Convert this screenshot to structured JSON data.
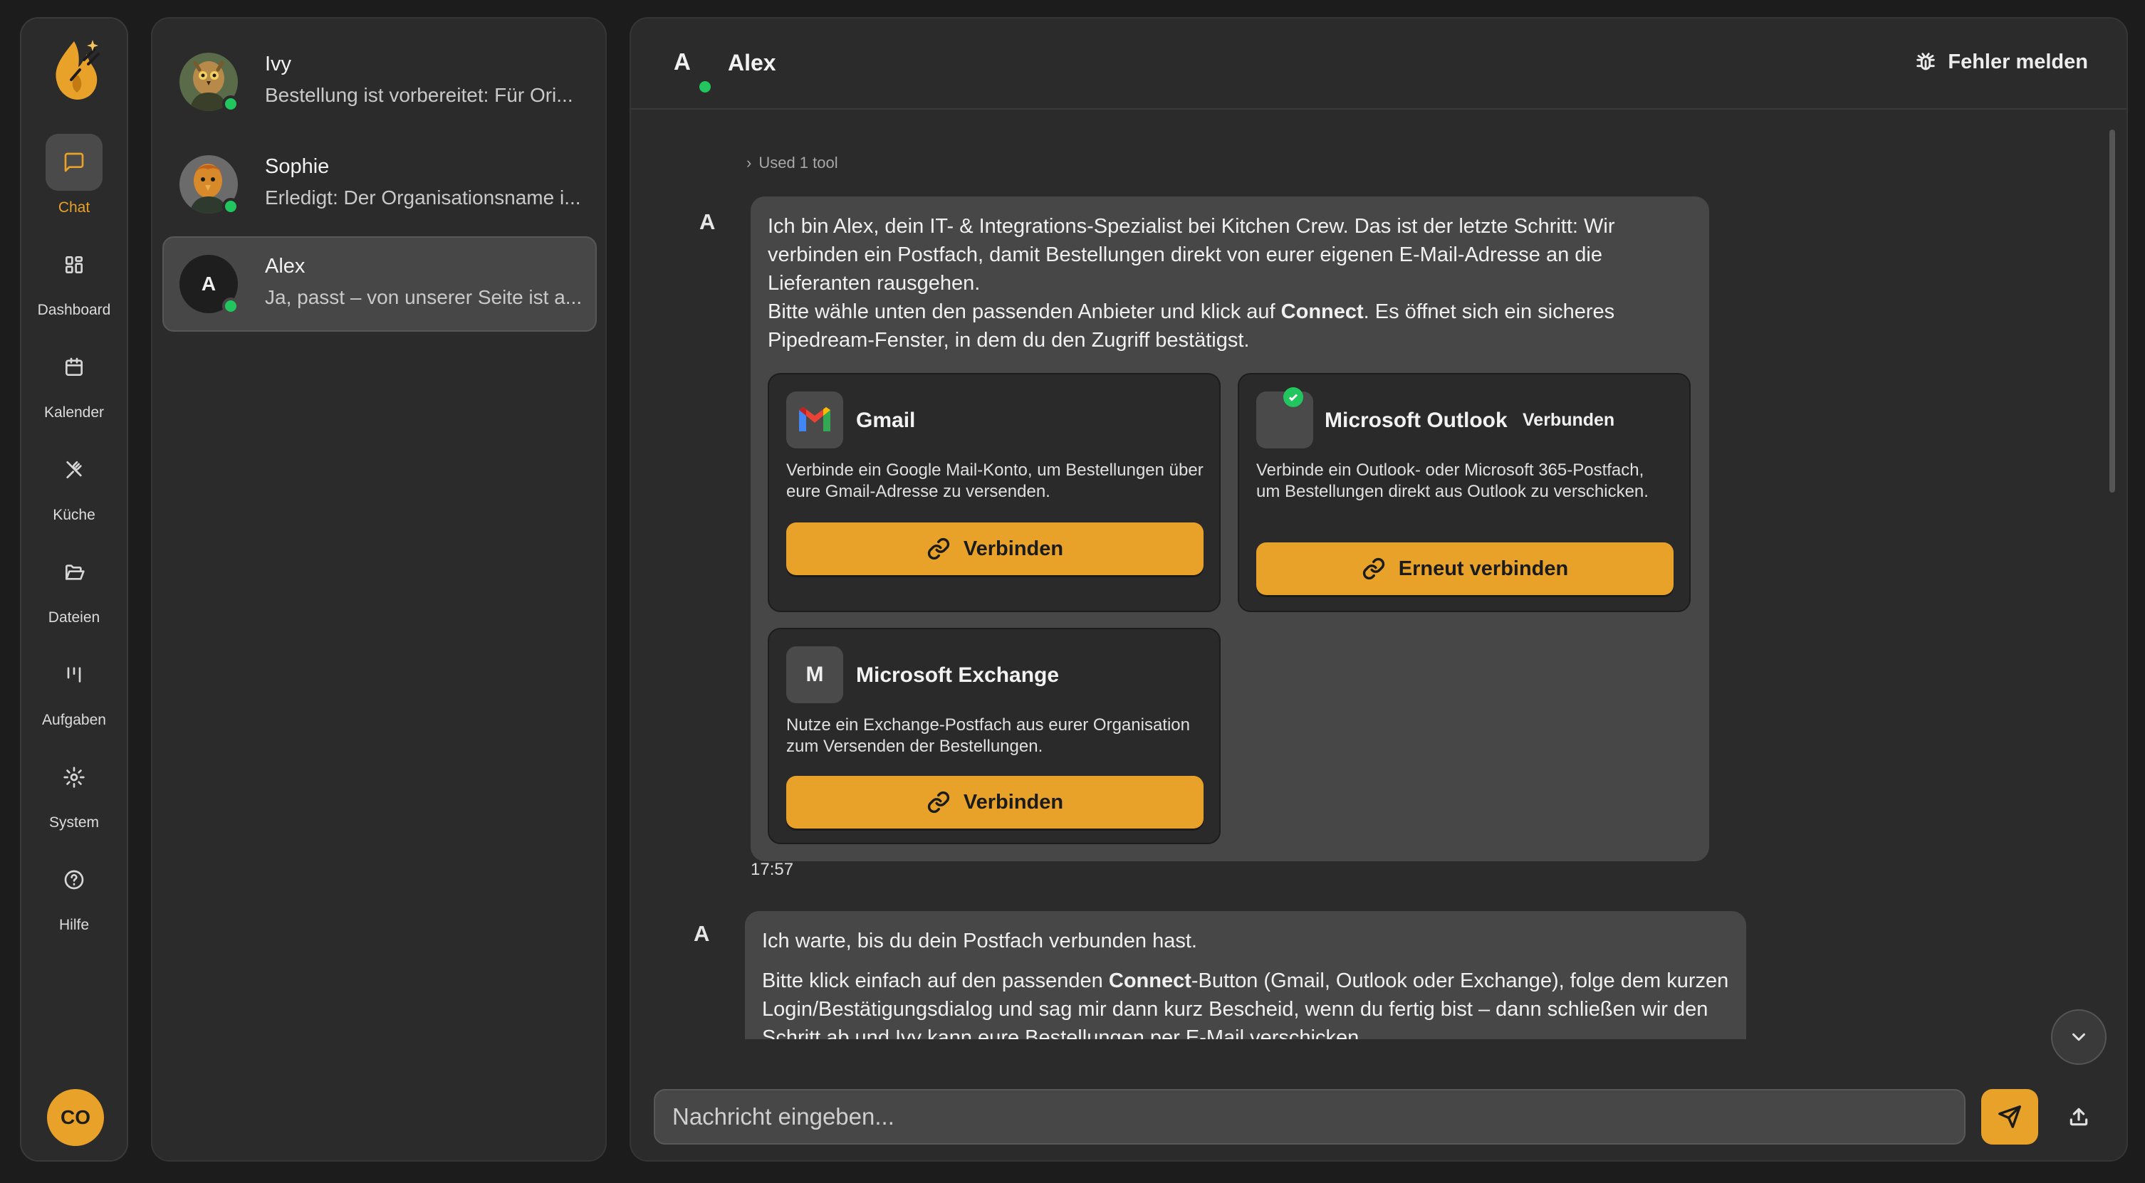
{
  "nav": {
    "items": [
      {
        "label": "Chat",
        "icon": "message-square-icon",
        "active": true
      },
      {
        "label": "Dashboard",
        "icon": "dashboard-grid-icon"
      },
      {
        "label": "Kalender",
        "icon": "calendar-icon"
      },
      {
        "label": "Küche",
        "icon": "utensils-icon"
      },
      {
        "label": "Dateien",
        "icon": "folder-open-icon"
      },
      {
        "label": "Aufgaben",
        "icon": "kanban-icon"
      },
      {
        "label": "System",
        "icon": "gear-icon"
      },
      {
        "label": "Hilfe",
        "icon": "help-circle-icon"
      }
    ],
    "user_initials": "CO",
    "accent_color": "#e8a229"
  },
  "conversations": [
    {
      "name": "Ivy",
      "preview": "Bestellung ist vorbereitet: Für Ori...",
      "online": true
    },
    {
      "name": "Sophie",
      "preview": "Erledigt: Der Organisationsname i...",
      "online": true
    },
    {
      "name": "Alex",
      "avatar_letter": "A",
      "preview": "Ja, passt – von unserer Seite ist a...",
      "online": true,
      "active": true
    }
  ],
  "header": {
    "avatar_letter": "A",
    "name": "Alex",
    "report_label": "Fehler melden"
  },
  "messages": {
    "used_tool": "Used 1 tool",
    "msg1": {
      "sender_letter": "A",
      "p1": "Ich bin Alex, dein IT- & Integrations-Spezialist bei Kitchen Crew. Das ist der letzte Schritt: Wir verbinden ein Postfach, damit Bestellungen direkt von eurer eigenen E-Mail-Adresse an die Lieferanten rausgehen.",
      "p2_before": "Bitte wähle unten den passenden Anbieter und klick auf ",
      "p2_bold": "Connect",
      "p2_after": ". Es öffnet sich ein sicheres Pipedream-Fenster, in dem du den Zugriff bestätigst.",
      "time": "17:57"
    },
    "providers": [
      {
        "name": "Gmail",
        "description": "Verbinde ein Google Mail-Konto, um Bestellungen über eure Gmail-Adresse zu versenden.",
        "button": "Verbinden"
      },
      {
        "name": "Microsoft Outlook",
        "status": "Verbunden",
        "description": "Verbinde ein Outlook- oder Microsoft 365-Postfach, um Bestellungen direkt aus Outlook zu verschicken.",
        "button": "Erneut verbinden"
      },
      {
        "name": "Microsoft Exchange",
        "logo_letter": "M",
        "description": "Nutze ein Exchange-Postfach aus eurer Organisation zum Versenden der Bestellungen.",
        "button": "Verbinden"
      }
    ],
    "msg2": {
      "sender_letter": "A",
      "p1": "Ich warte, bis du dein Postfach verbunden hast.",
      "p2_before": "Bitte klick einfach auf den passenden ",
      "p2_bold": "Connect",
      "p2_after": "-Button (Gmail, Outlook oder Exchange), folge dem kurzen Login/Bestätigungsdialog und sag mir dann kurz Bescheid, wenn du fertig bist – dann schließen wir den Schritt ab und Ivy kann eure Bestellungen per E-Mail verschicken."
    }
  },
  "composer": {
    "placeholder": "Nachricht eingeben..."
  }
}
